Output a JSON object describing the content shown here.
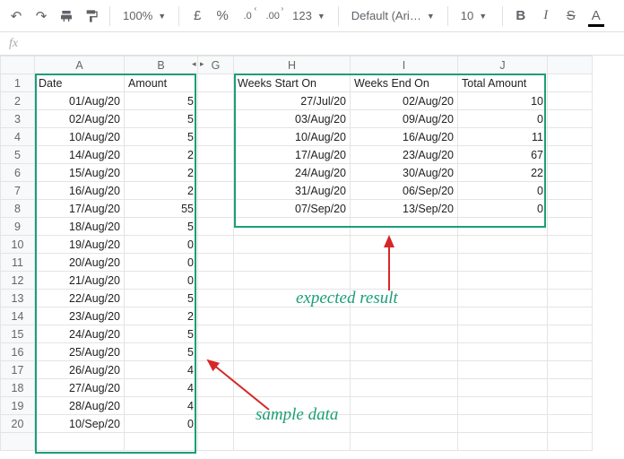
{
  "toolbar": {
    "zoom": "100%",
    "currency": "£",
    "percent": "%",
    "dec_dec": ".0",
    "inc_dec": ".00",
    "numfmt": "123",
    "font": "Default (Ari…",
    "fontsize": "10",
    "bold": "B",
    "italic": "I",
    "strike": "S",
    "textcolor": "A"
  },
  "fx": {
    "label": "fx",
    "value": ""
  },
  "cols": [
    "A",
    "B",
    "G",
    "H",
    "I",
    "J",
    ""
  ],
  "rows": [
    "1",
    "2",
    "3",
    "4",
    "5",
    "6",
    "7",
    "8",
    "9",
    "10",
    "11",
    "12",
    "13",
    "14",
    "15",
    "16",
    "17",
    "18",
    "19",
    "20",
    ""
  ],
  "left": {
    "header": {
      "date": "Date",
      "amount": "Amount"
    },
    "rows": [
      {
        "date": "01/Aug/20",
        "amt": "5"
      },
      {
        "date": "02/Aug/20",
        "amt": "5"
      },
      {
        "date": "10/Aug/20",
        "amt": "5"
      },
      {
        "date": "14/Aug/20",
        "amt": "2"
      },
      {
        "date": "15/Aug/20",
        "amt": "2"
      },
      {
        "date": "16/Aug/20",
        "amt": "2"
      },
      {
        "date": "17/Aug/20",
        "amt": "55"
      },
      {
        "date": "18/Aug/20",
        "amt": "5"
      },
      {
        "date": "19/Aug/20",
        "amt": "0"
      },
      {
        "date": "20/Aug/20",
        "amt": "0"
      },
      {
        "date": "21/Aug/20",
        "amt": "0"
      },
      {
        "date": "22/Aug/20",
        "amt": "5"
      },
      {
        "date": "23/Aug/20",
        "amt": "2"
      },
      {
        "date": "24/Aug/20",
        "amt": "5"
      },
      {
        "date": "25/Aug/20",
        "amt": "5"
      },
      {
        "date": "26/Aug/20",
        "amt": "4"
      },
      {
        "date": "27/Aug/20",
        "amt": "4"
      },
      {
        "date": "28/Aug/20",
        "amt": "4"
      },
      {
        "date": "10/Sep/20",
        "amt": "0"
      }
    ]
  },
  "right": {
    "header": {
      "start": "Weeks Start On",
      "end": "Weeks End On",
      "total": "Total Amount"
    },
    "rows": [
      {
        "start": "27/Jul/20",
        "end": "02/Aug/20",
        "total": "10"
      },
      {
        "start": "03/Aug/20",
        "end": "09/Aug/20",
        "total": "0"
      },
      {
        "start": "10/Aug/20",
        "end": "16/Aug/20",
        "total": "11"
      },
      {
        "start": "17/Aug/20",
        "end": "23/Aug/20",
        "total": "67"
      },
      {
        "start": "24/Aug/20",
        "end": "30/Aug/20",
        "total": "22"
      },
      {
        "start": "31/Aug/20",
        "end": "06/Sep/20",
        "total": "0"
      },
      {
        "start": "07/Sep/20",
        "end": "13/Sep/20",
        "total": "0"
      }
    ]
  },
  "annot": {
    "sample": "sample data",
    "expected": "expected result"
  }
}
